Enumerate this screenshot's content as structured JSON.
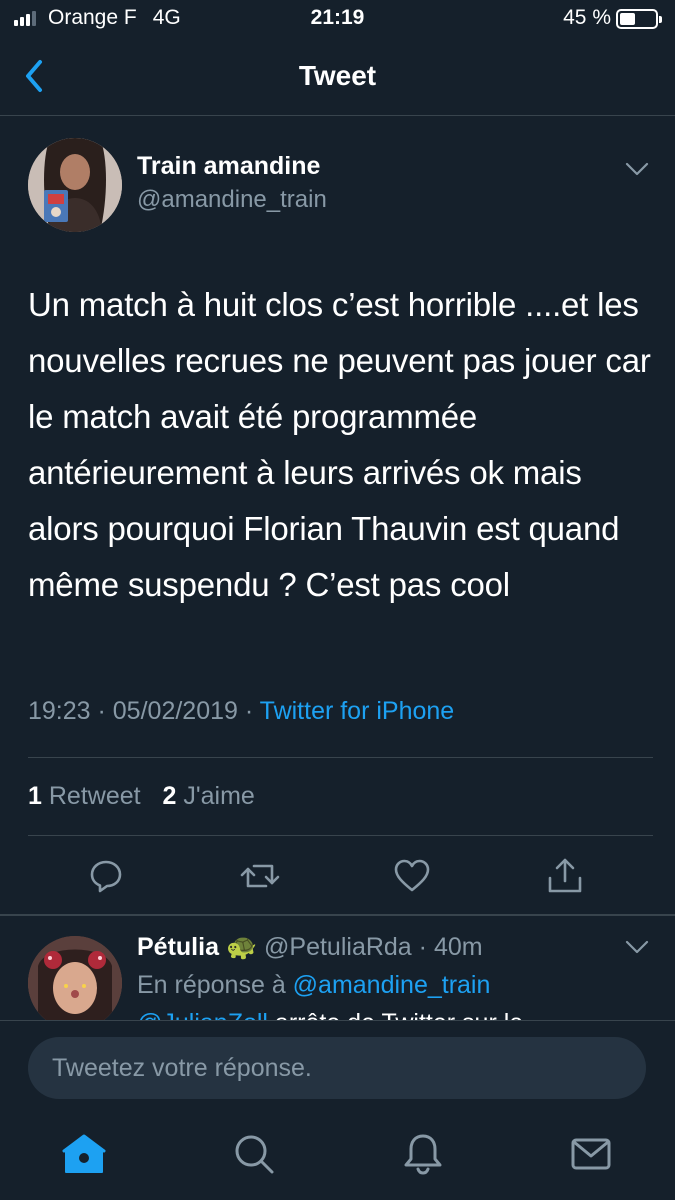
{
  "status_bar": {
    "carrier": "Orange F",
    "network": "4G",
    "time": "21:19",
    "battery_percent_label": "45 %",
    "battery_level": 0.45,
    "signal_bars": 3
  },
  "navbar": {
    "title": "Tweet",
    "back_icon": "chevron-left-icon"
  },
  "tweet": {
    "display_name": "Train amandine",
    "handle": "@amandine_train",
    "text": "Un match à huit clos c’est horrible ....et les nouvelles recrues ne peuvent pas jouer car le match avait été programmée antérieurement à leurs arrivés ok mais alors pourquoi Florian Thauvin est quand même suspendu ? C’est pas cool",
    "time": "19:23",
    "date": "05/02/2019",
    "source": "Twitter for iPhone",
    "retweet_count": "1",
    "retweet_label": "Retweet",
    "like_count": "2",
    "like_label": "J'aime"
  },
  "reply": {
    "display_name": "Pétulia",
    "emoji": "🐢",
    "handle": "@PetuliaRda",
    "age": "40m",
    "in_reply_prefix": "En réponse à",
    "in_reply_mention": "@amandine_train",
    "text_mention": "@JulianZoll",
    "text_rest": " arrête de Twitter sur le"
  },
  "composer": {
    "placeholder": "Tweetez votre réponse."
  },
  "colors": {
    "background": "#15202b",
    "accent": "#1da1f2",
    "secondary_text": "#8899a6",
    "divider": "#38444d"
  },
  "tabbar": {
    "icons": [
      "home-icon",
      "search-icon",
      "notifications-icon",
      "messages-icon"
    ],
    "active": "home-icon"
  }
}
